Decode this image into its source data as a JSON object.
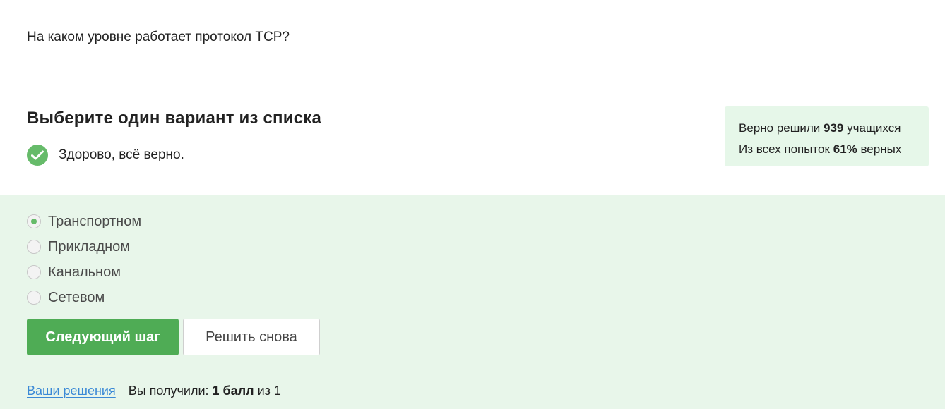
{
  "question": {
    "text": "На каком уровне работает протокол TCP?"
  },
  "task": {
    "title": "Выберите один вариант из списка",
    "feedback": "Здорово, всё верно."
  },
  "stats": {
    "solved_prefix": "Верно решили ",
    "solved_count": "939",
    "solved_suffix": " учащихся",
    "attempts_prefix": "Из всех попыток ",
    "attempts_percent": "61%",
    "attempts_suffix": " верных"
  },
  "options": [
    {
      "label": "Транспортном",
      "selected": true
    },
    {
      "label": "Прикладном",
      "selected": false
    },
    {
      "label": "Канальном",
      "selected": false
    },
    {
      "label": "Сетевом",
      "selected": false
    }
  ],
  "buttons": {
    "next": "Следующий шаг",
    "retry": "Решить снова"
  },
  "footer": {
    "solutions_link": "Ваши решения",
    "score_prefix": "Вы получили: ",
    "score_value": "1 балл",
    "score_suffix": " из 1"
  },
  "colors": {
    "accent_green": "#4fac55",
    "check_green": "#66bb6a",
    "answer_bg": "#e8f6ea",
    "stats_bg": "#e6f7e9",
    "link_blue": "#3b89d6"
  }
}
